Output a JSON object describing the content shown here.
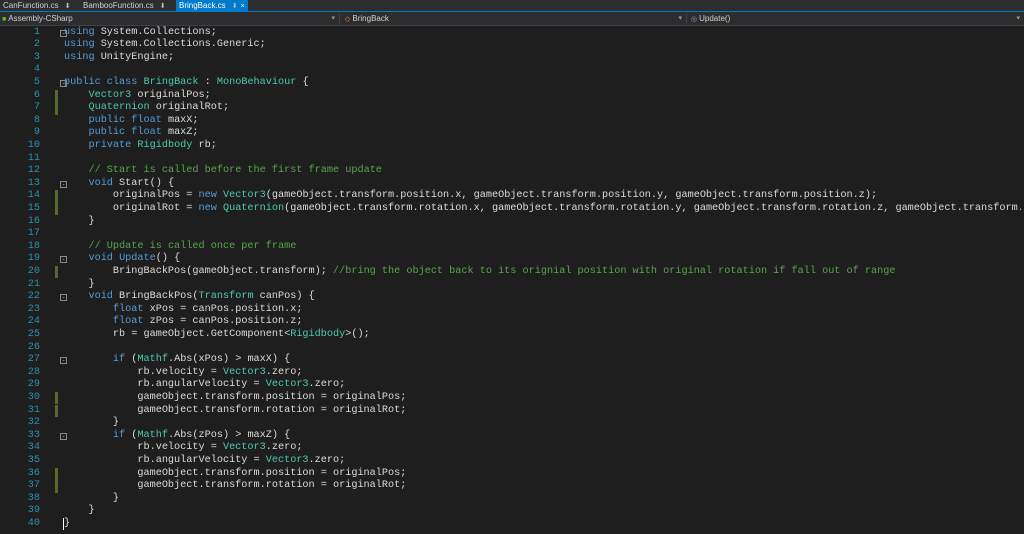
{
  "tabs": [
    {
      "label": "CanFunction.cs",
      "pin": "⬇"
    },
    {
      "label": "BambooFunction.cs",
      "pin": "⬇"
    },
    {
      "label": "BringBack.cs",
      "pin": "⬇",
      "close": "×",
      "active": true
    }
  ],
  "nav": {
    "project": "Assembly-CSharp",
    "class": "BringBack",
    "member": "Update()"
  },
  "colors": {
    "keyword": "#569cd6",
    "type": "#4ec9b0",
    "comment": "#57a64a",
    "text": "#dcdcdc",
    "line_number": "#2b91af",
    "change_marker": "#57692a",
    "active_tab": "#007acc"
  },
  "lines": [
    {
      "n": "1",
      "fold": "-",
      "chg": false,
      "tokens": [
        [
          "kw",
          "using"
        ],
        [
          "t",
          " System.Collections;"
        ]
      ]
    },
    {
      "n": "2",
      "fold": "",
      "chg": false,
      "tokens": [
        [
          "kw",
          "using"
        ],
        [
          "t",
          " System.Collections.Generic;"
        ]
      ]
    },
    {
      "n": "3",
      "fold": "",
      "chg": false,
      "tokens": [
        [
          "kw",
          "using"
        ],
        [
          "t",
          " UnityEngine;"
        ]
      ]
    },
    {
      "n": "4",
      "fold": "",
      "chg": false,
      "tokens": []
    },
    {
      "n": "5",
      "fold": "-",
      "chg": false,
      "tokens": [
        [
          "kw",
          "public class"
        ],
        [
          "t",
          " "
        ],
        [
          "ty",
          "BringBack"
        ],
        [
          "t",
          " : "
        ],
        [
          "ty",
          "MonoBehaviour"
        ],
        [
          "t",
          " {"
        ]
      ]
    },
    {
      "n": "6",
      "fold": "",
      "chg": true,
      "tokens": [
        [
          "t",
          "    "
        ],
        [
          "ty",
          "Vector3"
        ],
        [
          "t",
          " originalPos;"
        ]
      ]
    },
    {
      "n": "7",
      "fold": "",
      "chg": true,
      "tokens": [
        [
          "t",
          "    "
        ],
        [
          "ty",
          "Quaternion"
        ],
        [
          "t",
          " originalRot;"
        ]
      ]
    },
    {
      "n": "8",
      "fold": "",
      "chg": false,
      "tokens": [
        [
          "t",
          "    "
        ],
        [
          "kw",
          "public float"
        ],
        [
          "t",
          " maxX;"
        ]
      ]
    },
    {
      "n": "9",
      "fold": "",
      "chg": false,
      "tokens": [
        [
          "t",
          "    "
        ],
        [
          "kw",
          "public float"
        ],
        [
          "t",
          " maxZ;"
        ]
      ]
    },
    {
      "n": "10",
      "fold": "",
      "chg": false,
      "tokens": [
        [
          "t",
          "    "
        ],
        [
          "kw",
          "private"
        ],
        [
          "t",
          " "
        ],
        [
          "ty",
          "Rigidbody"
        ],
        [
          "t",
          " rb;"
        ]
      ]
    },
    {
      "n": "11",
      "fold": "",
      "chg": false,
      "tokens": []
    },
    {
      "n": "12",
      "fold": "",
      "chg": false,
      "tokens": [
        [
          "t",
          "    "
        ],
        [
          "cm",
          "// Start is called before the first frame update"
        ]
      ]
    },
    {
      "n": "13",
      "fold": "-",
      "chg": false,
      "tokens": [
        [
          "t",
          "    "
        ],
        [
          "kw",
          "void"
        ],
        [
          "t",
          " Start() {"
        ]
      ]
    },
    {
      "n": "14",
      "fold": "",
      "chg": true,
      "tokens": [
        [
          "t",
          "        originalPos = "
        ],
        [
          "kw",
          "new"
        ],
        [
          "t",
          " "
        ],
        [
          "ty",
          "Vector3"
        ],
        [
          "t",
          "(gameObject.transform.position.x, gameObject.transform.position.y, gameObject.transform.position.z);"
        ]
      ]
    },
    {
      "n": "15",
      "fold": "",
      "chg": true,
      "tokens": [
        [
          "t",
          "        originalRot = "
        ],
        [
          "kw",
          "new"
        ],
        [
          "t",
          " "
        ],
        [
          "ty",
          "Quaternion"
        ],
        [
          "t",
          "(gameObject.transform.rotation.x, gameObject.transform.rotation.y, gameObject.transform.rotation.z, gameObject.transform.rotation.w);"
        ]
      ]
    },
    {
      "n": "16",
      "fold": "",
      "chg": false,
      "tokens": [
        [
          "t",
          "    }"
        ]
      ]
    },
    {
      "n": "17",
      "fold": "",
      "chg": false,
      "tokens": []
    },
    {
      "n": "18",
      "fold": "",
      "chg": false,
      "tokens": [
        [
          "t",
          "    "
        ],
        [
          "cm",
          "// Update is called once per frame"
        ]
      ]
    },
    {
      "n": "19",
      "fold": "-",
      "chg": false,
      "tokens": [
        [
          "t",
          "    "
        ],
        [
          "kw",
          "void"
        ],
        [
          "t",
          " "
        ],
        [
          "kw",
          "Update"
        ],
        [
          "t",
          "() {"
        ]
      ]
    },
    {
      "n": "20",
      "fold": "",
      "chg": true,
      "tokens": [
        [
          "t",
          "        BringBackPos(gameObject.transform); "
        ],
        [
          "cm",
          "//bring the object back to its orignial position with original rotation if fall out of range"
        ]
      ]
    },
    {
      "n": "21",
      "fold": "",
      "chg": false,
      "tokens": [
        [
          "t",
          "    }"
        ]
      ]
    },
    {
      "n": "22",
      "fold": "-",
      "chg": false,
      "tokens": [
        [
          "t",
          "    "
        ],
        [
          "kw",
          "void"
        ],
        [
          "t",
          " BringBackPos("
        ],
        [
          "ty",
          "Transform"
        ],
        [
          "t",
          " canPos) {"
        ]
      ]
    },
    {
      "n": "23",
      "fold": "",
      "chg": false,
      "tokens": [
        [
          "t",
          "        "
        ],
        [
          "kw",
          "float"
        ],
        [
          "t",
          " xPos = canPos.position.x;"
        ]
      ]
    },
    {
      "n": "24",
      "fold": "",
      "chg": false,
      "tokens": [
        [
          "t",
          "        "
        ],
        [
          "kw",
          "float"
        ],
        [
          "t",
          " zPos = canPos.position.z;"
        ]
      ]
    },
    {
      "n": "25",
      "fold": "",
      "chg": false,
      "tokens": [
        [
          "t",
          "        rb = gameObject.GetComponent<"
        ],
        [
          "ty",
          "Rigidbody"
        ],
        [
          "t",
          ">();"
        ]
      ]
    },
    {
      "n": "26",
      "fold": "",
      "chg": false,
      "tokens": []
    },
    {
      "n": "27",
      "fold": "-",
      "chg": false,
      "tokens": [
        [
          "t",
          "        "
        ],
        [
          "kw",
          "if"
        ],
        [
          "t",
          " ("
        ],
        [
          "ty",
          "Mathf"
        ],
        [
          "t",
          ".Abs(xPos) > maxX) {"
        ]
      ]
    },
    {
      "n": "28",
      "fold": "",
      "chg": false,
      "tokens": [
        [
          "t",
          "            rb.velocity = "
        ],
        [
          "ty",
          "Vector3"
        ],
        [
          "t",
          ".zero;"
        ]
      ]
    },
    {
      "n": "29",
      "fold": "",
      "chg": false,
      "tokens": [
        [
          "t",
          "            rb.angularVelocity = "
        ],
        [
          "ty",
          "Vector3"
        ],
        [
          "t",
          ".zero;"
        ]
      ]
    },
    {
      "n": "30",
      "fold": "",
      "chg": true,
      "tokens": [
        [
          "t",
          "            gameObject.transform.position = originalPos;"
        ]
      ]
    },
    {
      "n": "31",
      "fold": "",
      "chg": true,
      "tokens": [
        [
          "t",
          "            gameObject.transform.rotation = originalRot;"
        ]
      ]
    },
    {
      "n": "32",
      "fold": "",
      "chg": false,
      "tokens": [
        [
          "t",
          "        }"
        ]
      ]
    },
    {
      "n": "33",
      "fold": "-",
      "chg": false,
      "tokens": [
        [
          "t",
          "        "
        ],
        [
          "kw",
          "if"
        ],
        [
          "t",
          " ("
        ],
        [
          "ty",
          "Mathf"
        ],
        [
          "t",
          ".Abs(zPos) > maxZ) {"
        ]
      ]
    },
    {
      "n": "34",
      "fold": "",
      "chg": false,
      "tokens": [
        [
          "t",
          "            rb.velocity = "
        ],
        [
          "ty",
          "Vector3"
        ],
        [
          "t",
          ".zero;"
        ]
      ]
    },
    {
      "n": "35",
      "fold": "",
      "chg": false,
      "tokens": [
        [
          "t",
          "            rb.angularVelocity = "
        ],
        [
          "ty",
          "Vector3"
        ],
        [
          "t",
          ".zero;"
        ]
      ]
    },
    {
      "n": "36",
      "fold": "",
      "chg": true,
      "tokens": [
        [
          "t",
          "            gameObject.transform.position = originalPos;"
        ]
      ]
    },
    {
      "n": "37",
      "fold": "",
      "chg": true,
      "tokens": [
        [
          "t",
          "            gameObject.transform.rotation = originalRot;"
        ]
      ]
    },
    {
      "n": "38",
      "fold": "",
      "chg": false,
      "tokens": [
        [
          "t",
          "        }"
        ]
      ]
    },
    {
      "n": "39",
      "fold": "",
      "chg": false,
      "tokens": [
        [
          "t",
          "    }"
        ]
      ]
    },
    {
      "n": "40",
      "fold": "",
      "chg": false,
      "caret": true,
      "tokens": [
        [
          "t",
          "}"
        ]
      ]
    }
  ]
}
